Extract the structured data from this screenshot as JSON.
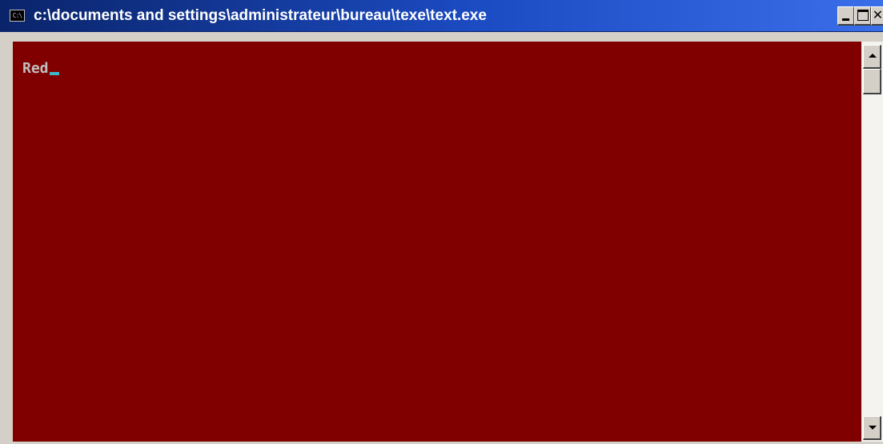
{
  "window": {
    "title": "c:\\documents and settings\\administrateur\\bureau\\texe\\text.exe",
    "icon": "console-app-icon",
    "icon_glyph": "C:\\",
    "controls": {
      "minimize_icon": "minimize-icon",
      "maximize_icon": "maximize-icon",
      "close_icon": "close-icon",
      "close_glyph": "✕"
    }
  },
  "console": {
    "background_color": "#800000",
    "text_color": "#c0c0c0",
    "cursor_color": "#3fb8c8",
    "lines": [
      "Red"
    ]
  },
  "scrollbar": {
    "up_icon": "arrow-up-icon",
    "down_icon": "arrow-down-icon"
  }
}
